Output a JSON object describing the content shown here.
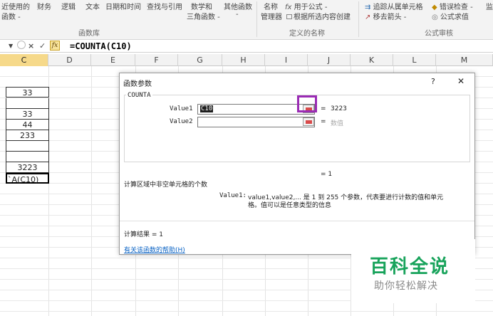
{
  "ribbon": {
    "recent": [
      "近使用的",
      "函数 -"
    ],
    "finance": "财务",
    "logic": "逻辑",
    "text": "文本",
    "datetime": "日期和时间",
    "lookup": "查找与引用",
    "math": [
      "数学和",
      "三角函数 -"
    ],
    "other": [
      "其他函数",
      "-"
    ],
    "name_mgr": [
      "名称",
      "管理器"
    ],
    "use_in_formula": "用于公式 -",
    "create_from_sel": "根据所选内容创建",
    "group_function_library": "函数库",
    "group_defined_names": "定义的名称",
    "trace_dependents": "追踪从属单元格",
    "error_check": "错误检查 -",
    "remove_arrows": "移去箭头 -",
    "evaluate": "公式求值",
    "group_formula_audit": "公式审核",
    "more": "监"
  },
  "formula_bar": {
    "cancel": "×",
    "enter": "✓",
    "fx": "fx",
    "formula": "=COUNTA(C10)"
  },
  "columns": [
    "C",
    "D",
    "E",
    "F",
    "G",
    "H",
    "I",
    "J",
    "K",
    "L",
    "M"
  ],
  "cells_c": [
    "33",
    "",
    "33",
    "44",
    "233",
    "",
    "",
    "3223",
    "`A(C10)"
  ],
  "dialog": {
    "title": "函数参数",
    "help": "?",
    "close": "✕",
    "function_name": "COUNTA",
    "value1_label": "Value1",
    "value1_input": "C10",
    "value1_result": "3223",
    "value2_label": "Value2",
    "value2_hint": "数值",
    "eq": "=",
    "total_result": "= 1",
    "description": "计算区域中非空单元格的个数",
    "param_desc_label": "Value1:",
    "param_desc_line1": "value1,value2,... 是 1 到 255 个参数，代表要进行计数的值和单元",
    "param_desc_line2": "格。值可以是任意类型的信息",
    "calc_result": "计算结果 = 1",
    "help_link": "有关该函数的帮助(H)"
  },
  "watermark": {
    "title": "百科全说",
    "subtitle": "助你轻松解决"
  }
}
